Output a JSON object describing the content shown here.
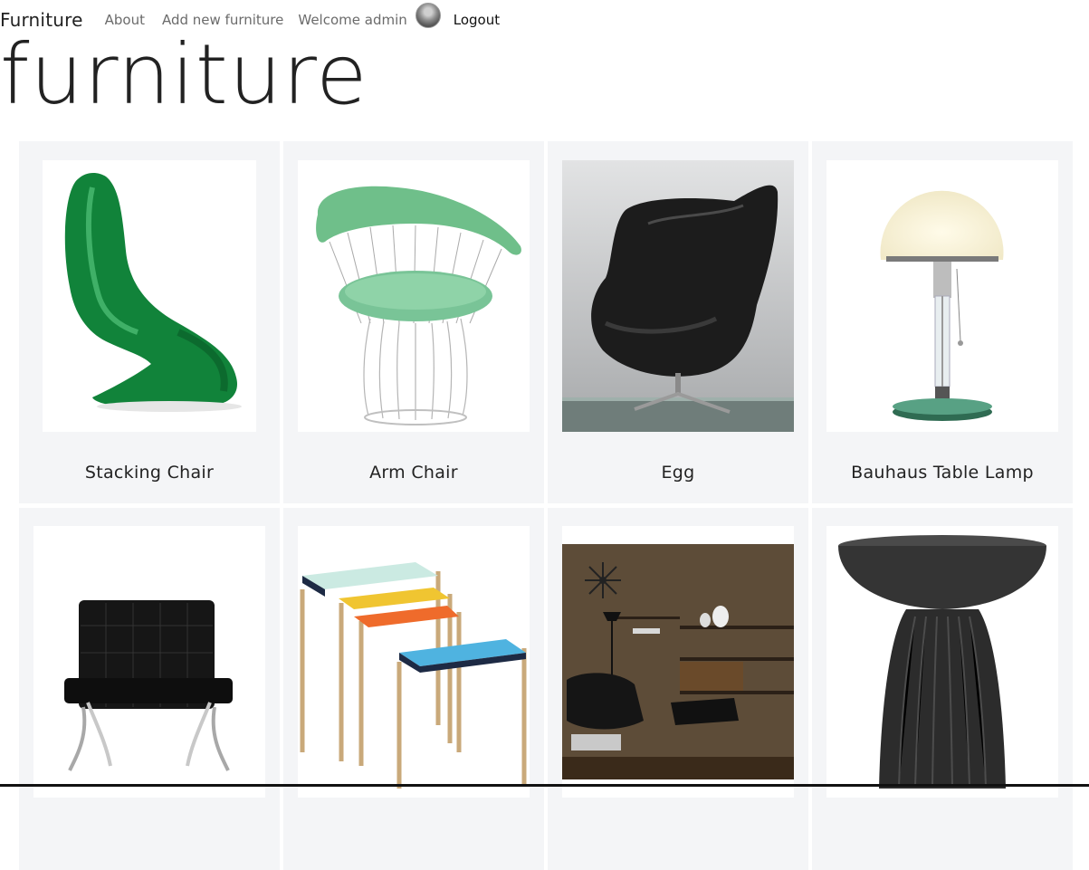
{
  "nav": {
    "brand": "Furniture",
    "about": "About",
    "add_new": "Add new furniture",
    "welcome": "Welcome admin",
    "logout": "Logout"
  },
  "page": {
    "title": "furniture"
  },
  "items": [
    {
      "label": "Stacking Chair",
      "icon": "green-panton-chair"
    },
    {
      "label": "Arm Chair",
      "icon": "wire-armchair-green-seat"
    },
    {
      "label": "Egg",
      "icon": "black-egg-chair"
    },
    {
      "label": "Bauhaus Table Lamp",
      "icon": "globe-table-lamp"
    },
    {
      "label": "",
      "icon": "black-leather-barcelona-chair"
    },
    {
      "label": "",
      "icon": "nesting-tables"
    },
    {
      "label": "",
      "icon": "living-room-shelving-scene"
    },
    {
      "label": "",
      "icon": "black-ribbed-side-table"
    }
  ],
  "colors": {
    "card_bg": "#f4f5f7",
    "nav_text": "#6b6b6b",
    "title": "#222222"
  }
}
